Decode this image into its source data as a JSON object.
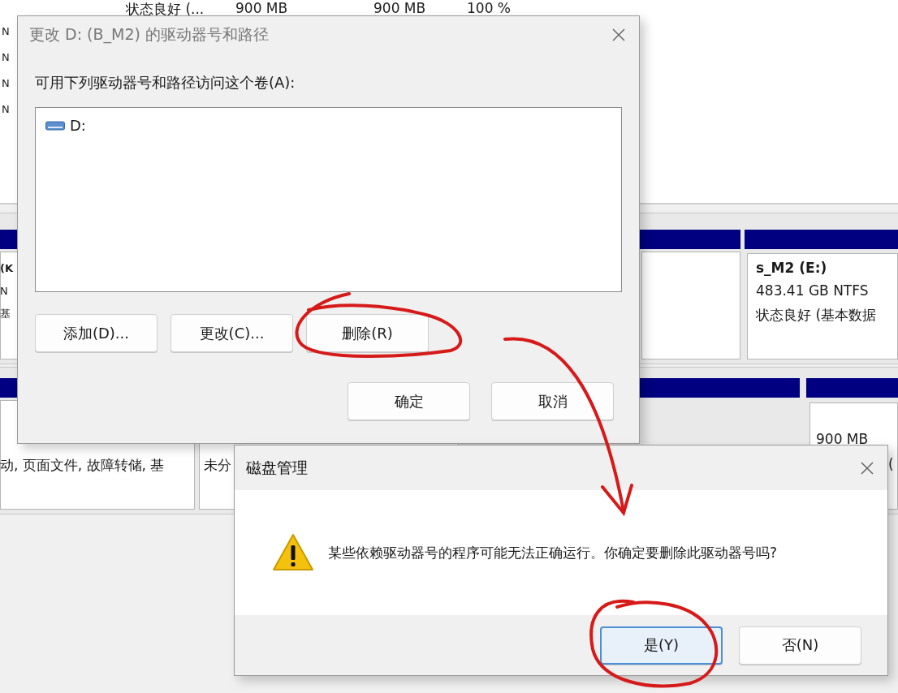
{
  "background": {
    "summary_row": [
      "状态良好 (...",
      "900 MB",
      "900 MB",
      "100 %"
    ],
    "list_column": [
      "N",
      "N",
      "N",
      "N"
    ],
    "disk_1": {
      "left_partition": [
        "(K",
        "N",
        "基"
      ],
      "right_partition": {
        "name": "s_M2  (E:)",
        "size": "483.41 GB NTFS",
        "status": "状态良好 (基本数据"
      }
    },
    "disk_2": {
      "left_partition": "动, 页面文件, 故障转储, 基",
      "second_partition": "未分",
      "right_partition": [
        "900 MB",
        "("
      ]
    }
  },
  "change_dialog": {
    "title": "更改 D: (B_M2) 的驱动器号和路径",
    "active": false,
    "label": "可用下列驱动器号和路径访问这个卷(A):",
    "paths": [
      {
        "label": "D:"
      }
    ],
    "buttons": [
      "添加(D)...",
      "更改(C)...",
      "删除(R)"
    ],
    "footer_buttons": [
      "确定",
      "取消"
    ]
  },
  "confirm_dialog": {
    "title": "磁盘管理",
    "active": true,
    "message": "某些依赖驱动器号的程序可能无法正确运行。你确定要删除此驱动器号吗?",
    "buttons": [
      {
        "label": "是(Y)",
        "default": true
      },
      {
        "label": "否(N)",
        "default": false
      }
    ]
  }
}
